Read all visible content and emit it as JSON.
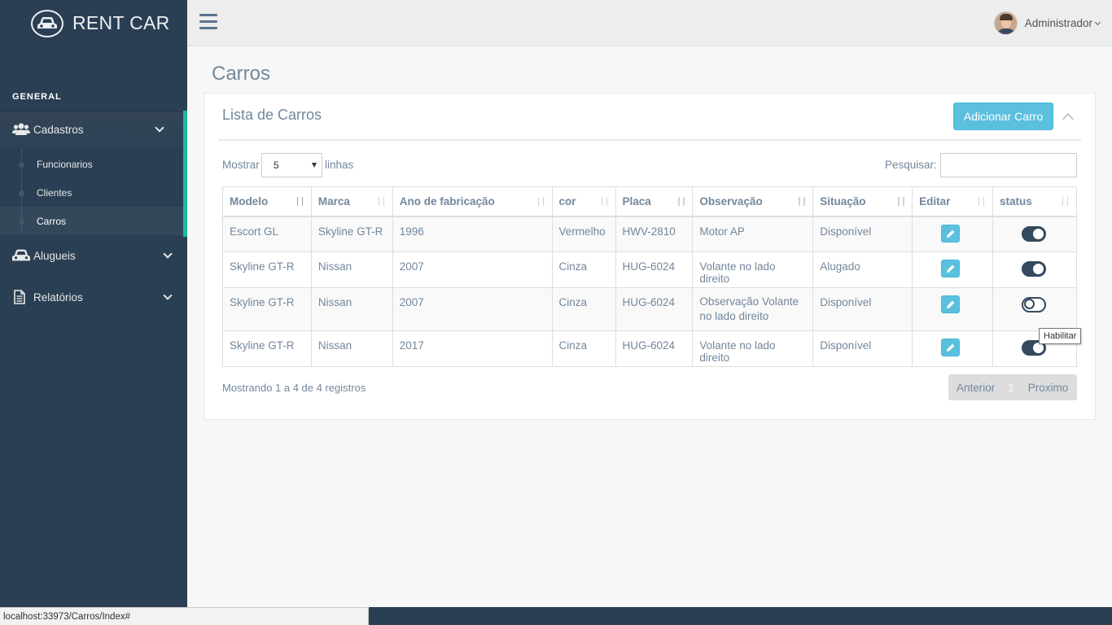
{
  "app": {
    "brand": "RENT CAR"
  },
  "sidebar": {
    "section_title": "GENERAL",
    "menu": [
      {
        "label": "Cadastros",
        "icon": "users-icon"
      },
      {
        "label": "Alugueis",
        "icon": "car-icon"
      },
      {
        "label": "Relatórios",
        "icon": "file-text-icon"
      }
    ],
    "submenu": [
      {
        "label": "Funcionarios"
      },
      {
        "label": "Clientes"
      },
      {
        "label": "Carros"
      }
    ]
  },
  "topnav": {
    "user_name": "Administrador"
  },
  "page": {
    "title": "Carros"
  },
  "panel": {
    "title": "Lista de Carros",
    "add_button": "Adicionar Carro",
    "show_label": "Mostrar",
    "show_value": "5",
    "lines_label": "linhas",
    "search_label": "Pesquisar:",
    "search_value": ""
  },
  "table": {
    "columns": [
      "Modelo",
      "Marca",
      "Ano de fabricação",
      "cor",
      "Placa",
      "Observação",
      "Situação",
      "Editar",
      "status"
    ],
    "rows": [
      {
        "modelo": "Escort GL",
        "marca": "Skyline GT-R",
        "ano": "1996",
        "cor": "Vermelho",
        "placa": "HWV-2810",
        "obs": "Motor AP",
        "situacao": "Disponível",
        "status_on": true
      },
      {
        "modelo": "Skyline GT-R",
        "marca": "Nissan",
        "ano": "2007",
        "cor": "Cinza",
        "placa": "HUG-6024",
        "obs": "Volante no lado direito",
        "situacao": "Alugado",
        "status_on": true
      },
      {
        "modelo": "Skyline GT-R",
        "marca": "Nissan",
        "ano": "2007",
        "cor": "Cinza",
        "placa": "HUG-6024",
        "obs": "Observação Volante no lado direito",
        "situacao": "Disponível",
        "status_on": false
      },
      {
        "modelo": "Skyline GT-R",
        "marca": "Nissan",
        "ano": "2017",
        "cor": "Cinza",
        "placa": "HUG-6024",
        "obs": "Volante no lado direito",
        "situacao": "Disponível",
        "status_on": true
      }
    ]
  },
  "footer": {
    "info": "Mostrando 1 a 4 de 4 registros",
    "prev": "Anterior",
    "page": "1",
    "next": "Proximo"
  },
  "tooltip": "Habilitar",
  "statusbar": "localhost:33973/Carros/Index#",
  "colors": {
    "sidebar": "#2A3F54",
    "accent": "#1ABB9C",
    "button": "#5BC0DE",
    "toggle": "#34495E"
  }
}
